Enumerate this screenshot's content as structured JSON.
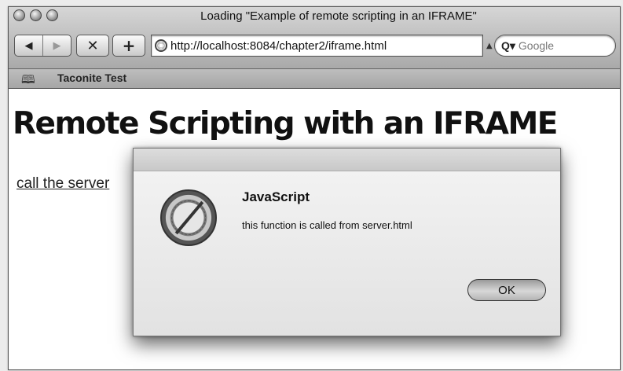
{
  "window": {
    "title": "Loading \"Example of remote scripting in an IFRAME\""
  },
  "toolbar": {
    "back_icon": "◀",
    "forward_icon": "▶",
    "stop_icon": "✕",
    "add_icon": "+",
    "address_value": "http://localhost:8084/chapter2/iframe.html",
    "search_placeholder": "Google"
  },
  "bookmarks": {
    "items": [
      {
        "label": "Taconite Test"
      }
    ]
  },
  "page": {
    "heading": "Remote Scripting with an IFRAME",
    "link_label": "call the server"
  },
  "alert": {
    "title": "JavaScript",
    "message": "this function is called from server.html",
    "ok_label": "OK"
  }
}
